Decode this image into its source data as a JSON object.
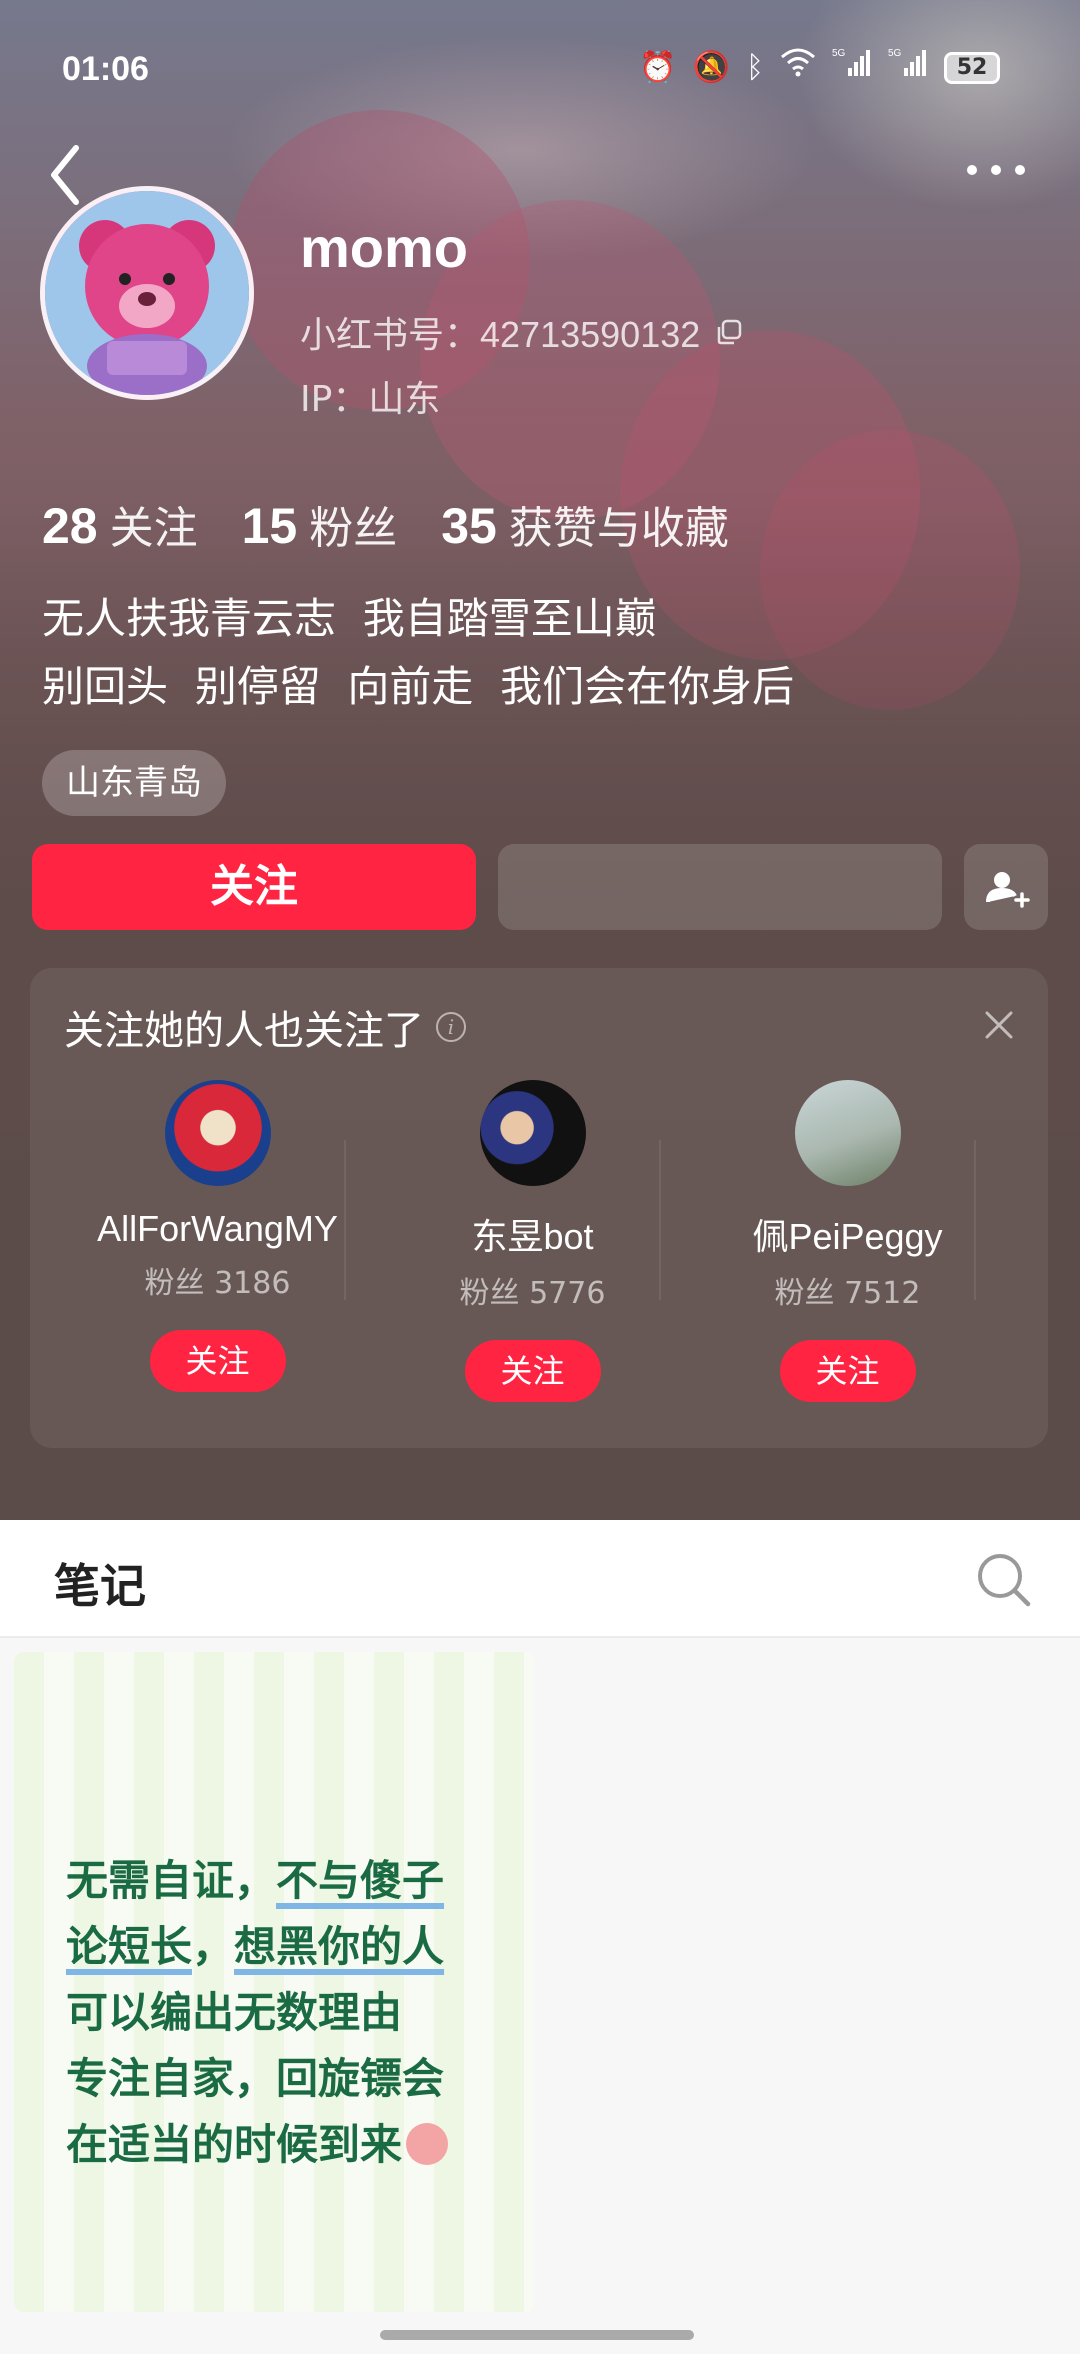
{
  "status_bar": {
    "time": "01:06",
    "battery": "52",
    "icons": [
      "alarm-icon",
      "mute-icon",
      "bluetooth-icon",
      "wifi-icon",
      "signal-5g-icon",
      "signal-5g-icon-2",
      "battery-icon"
    ]
  },
  "profile": {
    "nickname": "momo",
    "red_id_label": "小红书号：",
    "red_id": "42713590132",
    "ip_label": "IP：",
    "ip_value": "山东",
    "stats": [
      {
        "value": "28",
        "label": "关注"
      },
      {
        "value": "15",
        "label": "粉丝"
      },
      {
        "value": "35",
        "label": "获赞与收藏"
      }
    ],
    "bio_lines": [
      "无人扶我青云志  我自踏雪至山巅",
      "别回头  别停留  向前走  我们会在你身后"
    ],
    "location_tag": "山东青岛"
  },
  "actions": {
    "follow_label": "关注"
  },
  "recommend": {
    "title": "关注她的人也关注了",
    "users": [
      {
        "name": "AllForWangMY",
        "fans_label": "粉丝",
        "fans": "3186",
        "follow_label": "关注"
      },
      {
        "name": "东昱bot",
        "fans_label": "粉丝",
        "fans": "5776",
        "follow_label": "关注"
      },
      {
        "name": "佩PeiPeggy",
        "fans_label": "粉丝",
        "fans": "7512",
        "follow_label": "关注"
      }
    ]
  },
  "notes_tab": {
    "label": "笔记"
  },
  "notes": [
    {
      "line1_a": "无需自证，",
      "line1_b": "不与傻子",
      "line2_a": "论短长",
      "line2_b": "，",
      "line2_c": "想黑你的人",
      "line3": "可以编出无数理由",
      "line4": "专注自家，回旋镖会",
      "line5": "在适当的时候到来"
    }
  ],
  "colors": {
    "accent": "#ff2442",
    "note_text": "#1a6b44"
  }
}
